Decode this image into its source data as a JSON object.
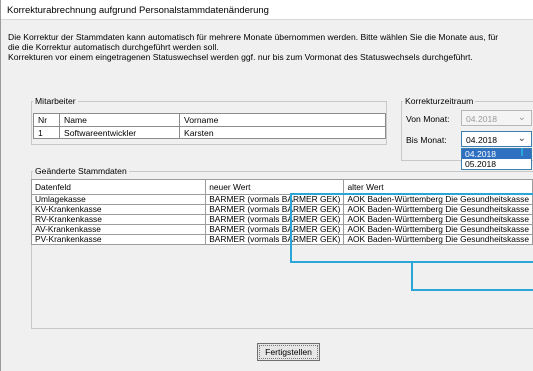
{
  "window": {
    "title": "Korrekturabrechnung aufgrund Personalstammdatenänderung"
  },
  "description": {
    "line1": "Die Korrektur der Stammdaten kann automatisch für mehrere Monate übernommen werden. Bitte wählen Sie die Monate aus, für",
    "line2": "die die Korrektur automatisch durchgeführt werden soll.",
    "line3": "Korrekturen vor einem eingetragenen Statuswechsel werden ggf. nur bis zum Vormonat des Statuswechsels durchgeführt."
  },
  "mitarbeiter": {
    "label": "Mitarbeiter",
    "columns": {
      "nr": "Nr",
      "name": "Name",
      "vorname": "Vorname"
    },
    "row": {
      "nr": "1",
      "name": "Softwareentwickler",
      "vorname": "Karsten"
    }
  },
  "korrekturzeitraum": {
    "label": "Korrekturzeitraum",
    "von_label": "Von Monat:",
    "von_value": "04.2018",
    "bis_label": "Bis Monat:",
    "bis_value": "04.2018",
    "options": [
      "04.2018",
      "05.2018"
    ]
  },
  "stammdaten": {
    "label": "Geänderte Stammdaten",
    "columns": {
      "datenfeld": "Datenfeld",
      "neu": "neuer Wert",
      "alt": "alter Wert"
    },
    "rows": [
      {
        "feld": "Umlagekasse",
        "neu": "BARMER (vormals BARMER GEK)",
        "alt": "AOK Baden-Württemberg Die Gesundheitskasse"
      },
      {
        "feld": "KV-Krankenkasse",
        "neu": "BARMER (vormals BARMER GEK)",
        "alt": "AOK Baden-Württemberg Die Gesundheitskasse"
      },
      {
        "feld": "RV-Krankenkasse",
        "neu": "BARMER (vormals BARMER GEK)",
        "alt": "AOK Baden-Württemberg Die Gesundheitskasse"
      },
      {
        "feld": "AV-Krankenkasse",
        "neu": "BARMER (vormals BARMER GEK)",
        "alt": "AOK Baden-Württemberg Die Gesundheitskasse"
      },
      {
        "feld": "PV-Krankenkasse",
        "neu": "BARMER (vormals BARMER GEK)",
        "alt": "AOK Baden-Württemberg Die Gesundheitskasse"
      }
    ]
  },
  "buttons": {
    "finish": "Fertigstellen"
  },
  "colors": {
    "highlight": "#2aa6d8",
    "selection": "#2f70c0"
  },
  "icons": {
    "combo_arrow": "chevron-down-icon"
  }
}
